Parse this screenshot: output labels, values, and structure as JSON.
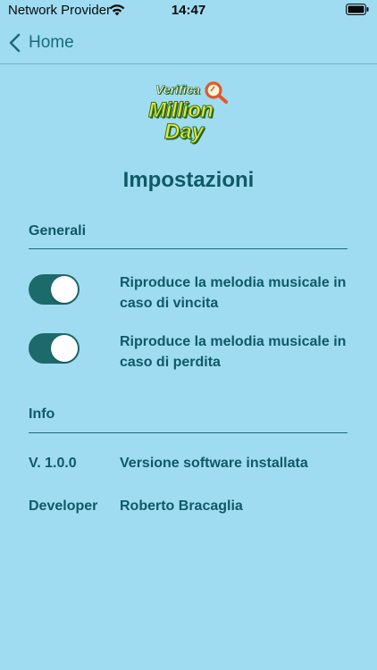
{
  "status_bar": {
    "carrier": "Network Provider",
    "time": "14:47"
  },
  "nav": {
    "back_label": "Home"
  },
  "logo": {
    "line1": "Verifica",
    "line2": "Million",
    "line3": "Day"
  },
  "page_title": "Impostazioni",
  "sections": {
    "general": {
      "header": "Generali",
      "toggles": [
        {
          "label": "Riproduce la melodia musicale in caso di vincita",
          "on": true
        },
        {
          "label": "Riproduce la melodia musicale in caso di perdita",
          "on": true
        }
      ]
    },
    "info": {
      "header": "Info",
      "rows": [
        {
          "key": "V. 1.0.0",
          "value": "Versione software installata"
        },
        {
          "key": "Developer",
          "value": "Roberto Bracaglia"
        }
      ]
    }
  },
  "colors": {
    "background": "#9fdcf2",
    "text_primary": "#0f5a66",
    "toggle_on": "#1d6a6a"
  }
}
